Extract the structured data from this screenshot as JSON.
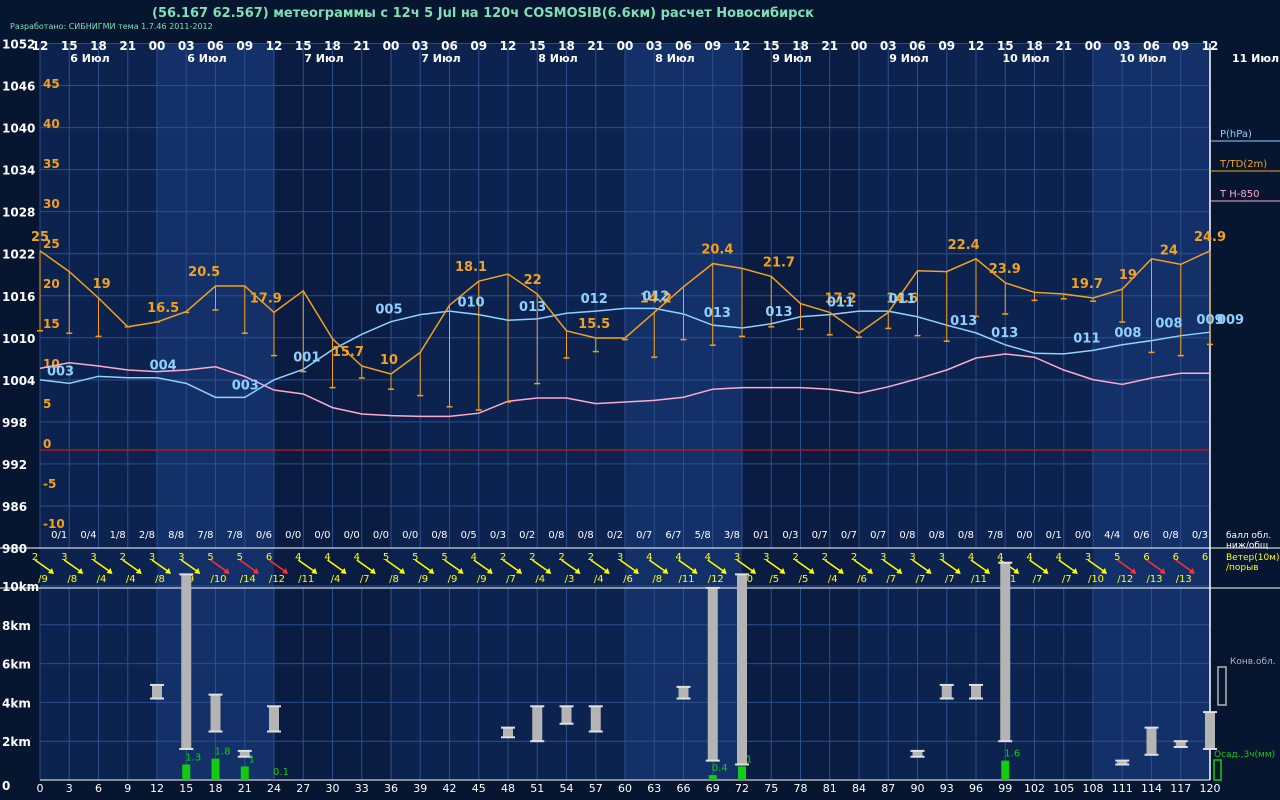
{
  "header": {
    "title": "(56.167 62.567) метеограммы с  12ч 5 Jul на 120ч COSMOSIB(6.6км) расчет Новосибирск",
    "developer": "Разработано: СИБНИГМИ тема 1.7.46 2011-2012"
  },
  "colors": {
    "pressure": "#8fd2ff",
    "temp": "#f2a21e",
    "t850": "#ffaacc",
    "wind": "#ffff00",
    "wind_strong": "#ff3030",
    "cloud": "#b4b4b4",
    "precip": "#11cc11",
    "axis_text": "#ffffff",
    "zero_line": "#aa1a1a"
  },
  "chart_data": [
    {
      "type": "line",
      "x": [
        0,
        3,
        6,
        9,
        12,
        15,
        18,
        21,
        24,
        27,
        30,
        33,
        36,
        39,
        42,
        45,
        48,
        51,
        54,
        57,
        60,
        63,
        66,
        69,
        72,
        75,
        78,
        81,
        84,
        87,
        90,
        93,
        96,
        99,
        102,
        105,
        108,
        111,
        114,
        117,
        120
      ],
      "hour_labels_top": [
        "12",
        "15",
        "18",
        "21",
        "00",
        "03",
        "06",
        "09",
        "12",
        "15",
        "18",
        "21",
        "00",
        "03",
        "06",
        "09",
        "12",
        "15",
        "18",
        "21",
        "00",
        "03",
        "06",
        "09",
        "12",
        "15",
        "18",
        "21",
        "00",
        "03",
        "06",
        "09",
        "12",
        "15",
        "18",
        "21",
        "00",
        "03",
        "06",
        "09",
        "12"
      ],
      "hour_labels_bottom": [
        "0",
        "3",
        "6",
        "9",
        "12",
        "15",
        "18",
        "21",
        "24",
        "27",
        "30",
        "33",
        "36",
        "39",
        "42",
        "45",
        "48",
        "51",
        "54",
        "57",
        "60",
        "63",
        "66",
        "69",
        "72",
        "75",
        "78",
        "81",
        "84",
        "87",
        "90",
        "93",
        "96",
        "99",
        "102",
        "105",
        "108",
        "111",
        "114",
        "117",
        "120"
      ],
      "date_labels": [
        "6 Июл",
        "6 Июл",
        "7 Июл",
        "7 Июл",
        "8 Июл",
        "8 Июл",
        "9 Июл",
        "9 Июл",
        "10 Июл",
        "10 Июл",
        "11 Июл"
      ],
      "pressure_axis": {
        "label": "P(hPa)",
        "ticks": [
          "1052",
          "1046",
          "1040",
          "1034",
          "1028",
          "1022",
          "1016",
          "1010",
          "1004",
          "998",
          "992",
          "986",
          "980"
        ],
        "range": [
          980,
          1052
        ]
      },
      "temp_axis": {
        "label": "T/TD(2m)",
        "ticks": [
          "45",
          "40",
          "35",
          "30",
          "25",
          "20",
          "15",
          "10",
          "5",
          "0",
          "-5",
          "-10"
        ],
        "range": [
          -13,
          50
        ]
      },
      "legend_t850": "T H-850",
      "series": [
        {
          "key": "pressure",
          "name": "P(hPa)",
          "values": [
            1004,
            1003.5,
            1004.5,
            1004.3,
            1004.3,
            1003.5,
            1001.5,
            1001.5,
            1004,
            1005.5,
            1008.3,
            1010.5,
            1012.3,
            1013.3,
            1013.8,
            1013.3,
            1012.5,
            1012.7,
            1013.5,
            1013.8,
            1014.2,
            1014.2,
            1013.4,
            1011.8,
            1011.4,
            1012,
            1013,
            1013.3,
            1013.8,
            1013.8,
            1013,
            1011.8,
            1010.7,
            1009,
            1007.8,
            1007.7,
            1008.2,
            1009,
            1009.6,
            1010.3,
            1010.8
          ]
        },
        {
          "key": "t850",
          "name": "T H-850",
          "values": [
            10.2,
            10.9,
            10.5,
            10,
            9.8,
            10,
            10.4,
            9.2,
            7.5,
            7,
            5.3,
            4.5,
            4.3,
            4.2,
            4.2,
            4.6,
            6.1,
            6.5,
            6.5,
            5.8,
            6,
            6.2,
            6.6,
            7.6,
            7.8,
            7.8,
            7.8,
            7.6,
            7.1,
            7.9,
            8.9,
            10,
            11.5,
            12,
            11.6,
            10,
            8.8,
            8.2,
            9,
            9.6,
            9.6
          ]
        },
        {
          "key": "temp",
          "name": "T/TD(2m)",
          "values": [
            24.9,
            22.3,
            19,
            15.4,
            16,
            17.3,
            20.5,
            20.5,
            17.2,
            19.9,
            13.9,
            10.5,
            9.5,
            12.2,
            18.1,
            21.1,
            22,
            19.5,
            14.9,
            14,
            14,
            17.2,
            20.4,
            23.3,
            22.7,
            21.7,
            18.3,
            17.2,
            14.6,
            17.2,
            22.4,
            22.3,
            23.9,
            20.9,
            19.7,
            19.5,
            19,
            20.1,
            23.9,
            23.2,
            24.9
          ]
        },
        {
          "key": "dewpoint",
          "name": "",
          "values": [
            14.9,
            14.6,
            14.2,
            15.4,
            16,
            17.2,
            17.5,
            14.6,
            11.8,
            9.8,
            7.8,
            9,
            7.6,
            6.8,
            5.4,
            5,
            6,
            8.3,
            11.5,
            12.3,
            13.8,
            11.6,
            13.8,
            13.1,
            14.2,
            15.4,
            15.1,
            14.4,
            14.1,
            15.2,
            14.3,
            13.6,
            16.7,
            17,
            18.7,
            18.9,
            18.6,
            16,
            12.2,
            11.8,
            13.2
          ]
        }
      ],
      "temp_labels": [
        {
          "x": 0,
          "text": "25"
        },
        {
          "x": 9,
          "text": "19"
        },
        {
          "x": 18,
          "text": "16.5"
        },
        {
          "x": 24,
          "text": "20.5"
        },
        {
          "x": 33,
          "text": "17.9"
        },
        {
          "x": 45,
          "text": "15.7"
        },
        {
          "x": 51,
          "text": "10"
        },
        {
          "x": 63,
          "text": "18.1"
        },
        {
          "x": 72,
          "text": "22"
        },
        {
          "x": 81,
          "text": "15.5"
        },
        {
          "x": 90,
          "text": "14.2"
        },
        {
          "x": 99,
          "text": "20.4"
        },
        {
          "x": 108,
          "text": "21.7"
        },
        {
          "x": 117,
          "text": "17.2"
        },
        {
          "x": 126,
          "text": "14.6"
        },
        {
          "x": 135,
          "text": "22.4"
        },
        {
          "x": 141,
          "text": "23.9"
        },
        {
          "x": 153,
          "text": "19.7"
        },
        {
          "x": 159,
          "text": "19"
        },
        {
          "x": 165,
          "text": "24"
        },
        {
          "x": 171,
          "text": "24.9"
        }
      ],
      "pressure_labels": [
        {
          "x": 3,
          "text": "003"
        },
        {
          "x": 18,
          "text": "004"
        },
        {
          "x": 30,
          "text": "003"
        },
        {
          "x": 39,
          "text": "001"
        },
        {
          "x": 51,
          "text": "005"
        },
        {
          "x": 63,
          "text": "010"
        },
        {
          "x": 72,
          "text": "013"
        },
        {
          "x": 81,
          "text": "012"
        },
        {
          "x": 90,
          "text": "012"
        },
        {
          "x": 99,
          "text": "013"
        },
        {
          "x": 108,
          "text": "013"
        },
        {
          "x": 117,
          "text": "011"
        },
        {
          "x": 126,
          "text": "011"
        },
        {
          "x": 135,
          "text": "013"
        },
        {
          "x": 141,
          "text": "013"
        },
        {
          "x": 153,
          "text": "011"
        },
        {
          "x": 159,
          "text": "008"
        },
        {
          "x": 165,
          "text": "008"
        },
        {
          "x": 171,
          "text": "009"
        },
        {
          "x": 174,
          "text": "009"
        }
      ],
      "cloud_fractions": [
        "0/1",
        "0/4",
        "1/8",
        "2/8",
        "8/8",
        "7/8",
        "7/8",
        "0/6",
        "0/0",
        "0/0",
        "0/0",
        "0/0",
        "0/0",
        "0/8",
        "0/5",
        "0/3",
        "0/2",
        "0/8",
        "0/8",
        "0/2",
        "0/7",
        "6/7",
        "5/8",
        "3/8",
        "0/1",
        "0/3",
        "0/7",
        "0/7",
        "0/7",
        "0/8",
        "0/8",
        "0/8",
        "7/8",
        "0/0",
        "0/1",
        "0/0",
        "4/4",
        "0/6",
        "0/8",
        "0/3"
      ],
      "cloud_label": "балл обл. ниж/общ"
    },
    {
      "type": "wind",
      "label": "Ветер(10м) /порыв",
      "speeds": [
        "2",
        "3",
        "3",
        "2",
        "3",
        "3",
        "5",
        "5",
        "6",
        "4",
        "4",
        "4",
        "5",
        "5",
        "5",
        "4",
        "2",
        "2",
        "2",
        "2",
        "3",
        "4",
        "4",
        "4",
        "3",
        "3",
        "2",
        "2",
        "2",
        "3",
        "3",
        "3",
        "4",
        "4",
        "4",
        "4",
        "3",
        "5",
        "6",
        "6",
        "6"
      ],
      "gusts": [
        "/9",
        "/8",
        "/4",
        "/4",
        "/8",
        "/9",
        "/10",
        "/14",
        "/12",
        "/11",
        "/4",
        "/7",
        "/8",
        "/9",
        "/9",
        "/9",
        "/7",
        "/4",
        "/3",
        "/4",
        "/6",
        "/8",
        "/11",
        "/12",
        "/10",
        "/5",
        "/5",
        "/4",
        "/6",
        "/7",
        "/7",
        "/7",
        "/11",
        "/11",
        "/7",
        "/7",
        "/10",
        "/12",
        "/13",
        "/13",
        ""
      ]
    },
    {
      "type": "bar",
      "label_cloud": "Конв.обл.",
      "label_precip": "Осад.,3ч(мм)",
      "y_ticks": [
        "10km",
        "8km",
        "6km",
        "4km",
        "2km",
        "0"
      ],
      "y_range": [
        0,
        11
      ],
      "cloud_bars": [
        {
          "x": 12,
          "bottom": 4.2,
          "top": 4.9
        },
        {
          "x": 15,
          "bottom": 1.6,
          "top": 10.6
        },
        {
          "x": 18,
          "bottom": 2.5,
          "top": 4.4
        },
        {
          "x": 21,
          "bottom": 1.2,
          "top": 1.5
        },
        {
          "x": 24,
          "bottom": 2.5,
          "top": 3.8
        },
        {
          "x": 48,
          "bottom": 2.2,
          "top": 2.7
        },
        {
          "x": 51,
          "bottom": 2.0,
          "top": 3.8
        },
        {
          "x": 54,
          "bottom": 2.9,
          "top": 3.8
        },
        {
          "x": 57,
          "bottom": 2.5,
          "top": 3.8
        },
        {
          "x": 66,
          "bottom": 4.2,
          "top": 4.8
        },
        {
          "x": 69,
          "bottom": 1.0,
          "top": 9.9
        },
        {
          "x": 72,
          "bottom": 0.8,
          "top": 10.6
        },
        {
          "x": 90,
          "bottom": 1.2,
          "top": 1.5
        },
        {
          "x": 93,
          "bottom": 4.2,
          "top": 4.9
        },
        {
          "x": 96,
          "bottom": 4.2,
          "top": 4.9
        },
        {
          "x": 99,
          "bottom": 2.0,
          "top": 11.2
        },
        {
          "x": 111,
          "bottom": 0.8,
          "top": 1.0
        },
        {
          "x": 114,
          "bottom": 1.3,
          "top": 2.7
        },
        {
          "x": 117,
          "bottom": 1.7,
          "top": 2.0
        },
        {
          "x": 120,
          "bottom": 1.6,
          "top": 3.5
        }
      ],
      "precip_bars": [
        {
          "x": 15,
          "value": 0.8,
          "label": "1.3"
        },
        {
          "x": 18,
          "value": 1.1,
          "label": "1.8"
        },
        {
          "x": 21,
          "value": 0.7,
          "label": "1"
        },
        {
          "x": 24,
          "value": 0.05,
          "label": "0.1"
        },
        {
          "x": 69,
          "value": 0.25,
          "label": "0.4"
        },
        {
          "x": 72,
          "value": 0.7,
          "label": "1"
        },
        {
          "x": 99,
          "value": 1.0,
          "label": "1.6"
        }
      ]
    }
  ]
}
